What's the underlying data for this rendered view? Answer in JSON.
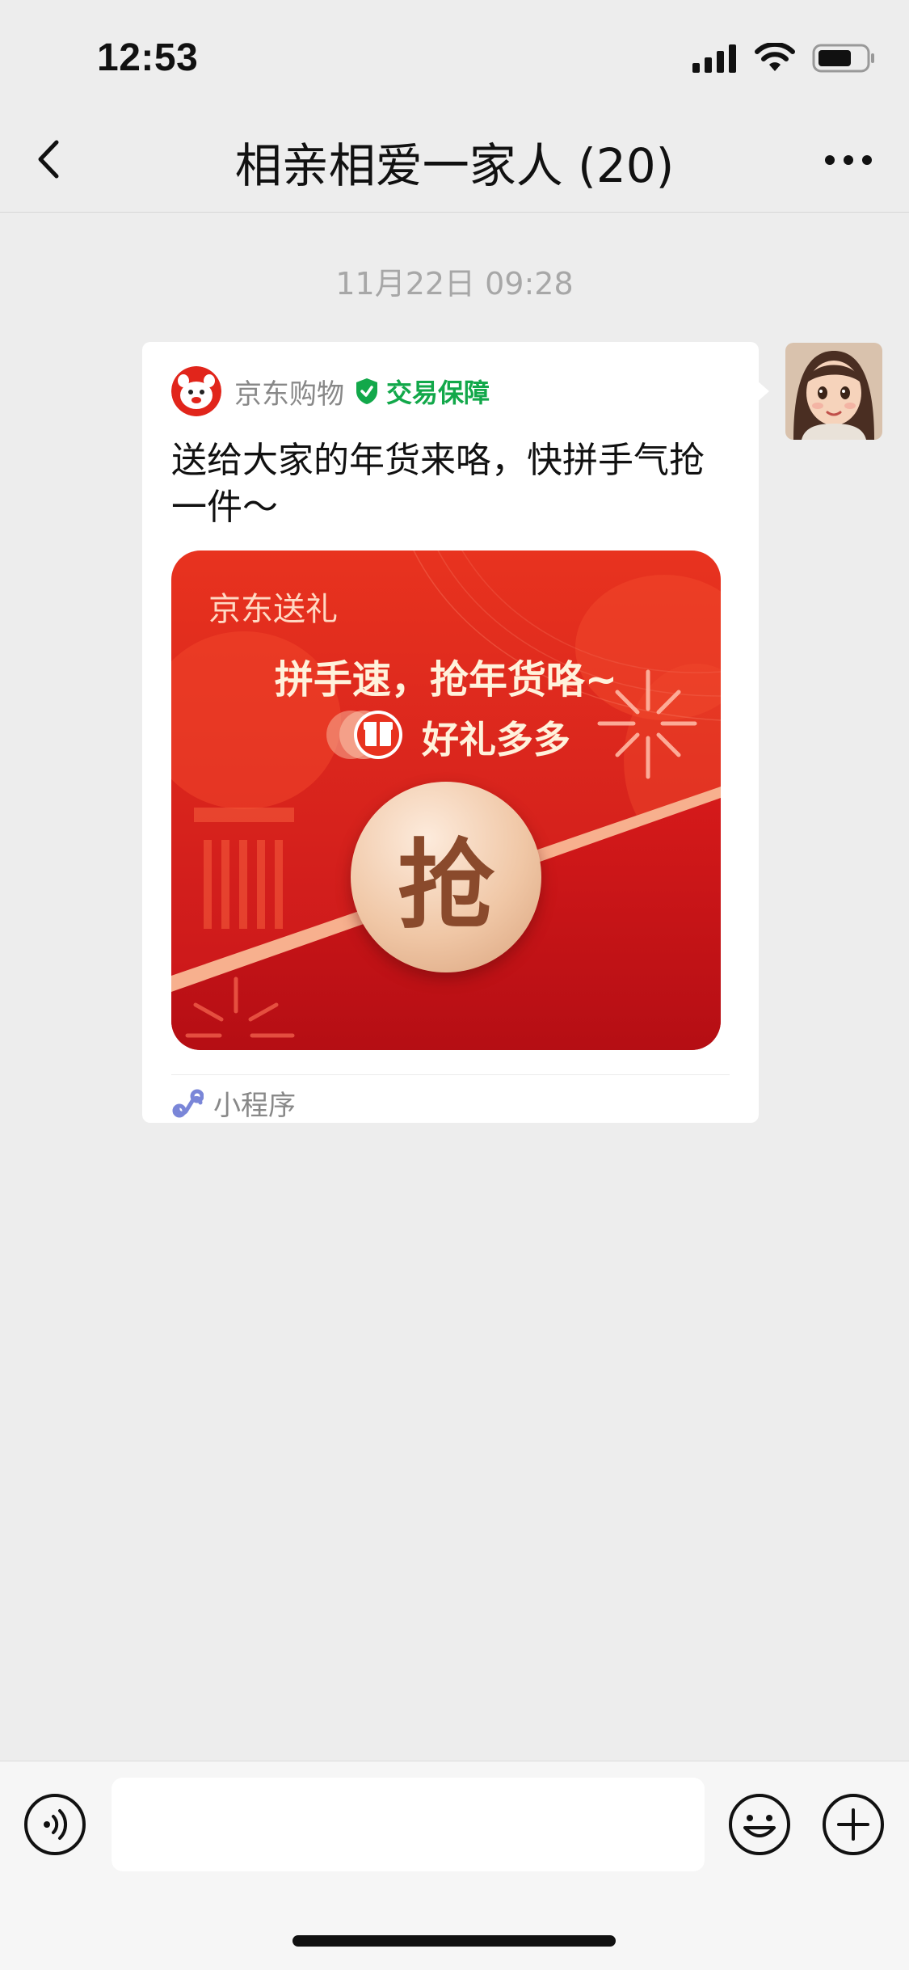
{
  "status_bar": {
    "time": "12:53"
  },
  "nav": {
    "title": "相亲相爱一家人 (20)"
  },
  "chat": {
    "timestamp": "11月22日 09:28",
    "card": {
      "app_name": "京东购物",
      "verified_label": "交易保障",
      "message": "送给大家的年货来咯，快拼手气抢一件～",
      "promo": {
        "brand": "京东送礼",
        "headline": "拼手速，抢年货咯~",
        "subline": "好礼多多",
        "grab_button": "抢"
      },
      "footer_label": "小程序"
    }
  },
  "input_bar": {
    "text_value": ""
  },
  "colors": {
    "background": "#ededed",
    "card": "#ffffff",
    "verified_green": "#12a84a",
    "promo_red": "#d8201b",
    "grab_button_gold": "#f0c7a6"
  }
}
